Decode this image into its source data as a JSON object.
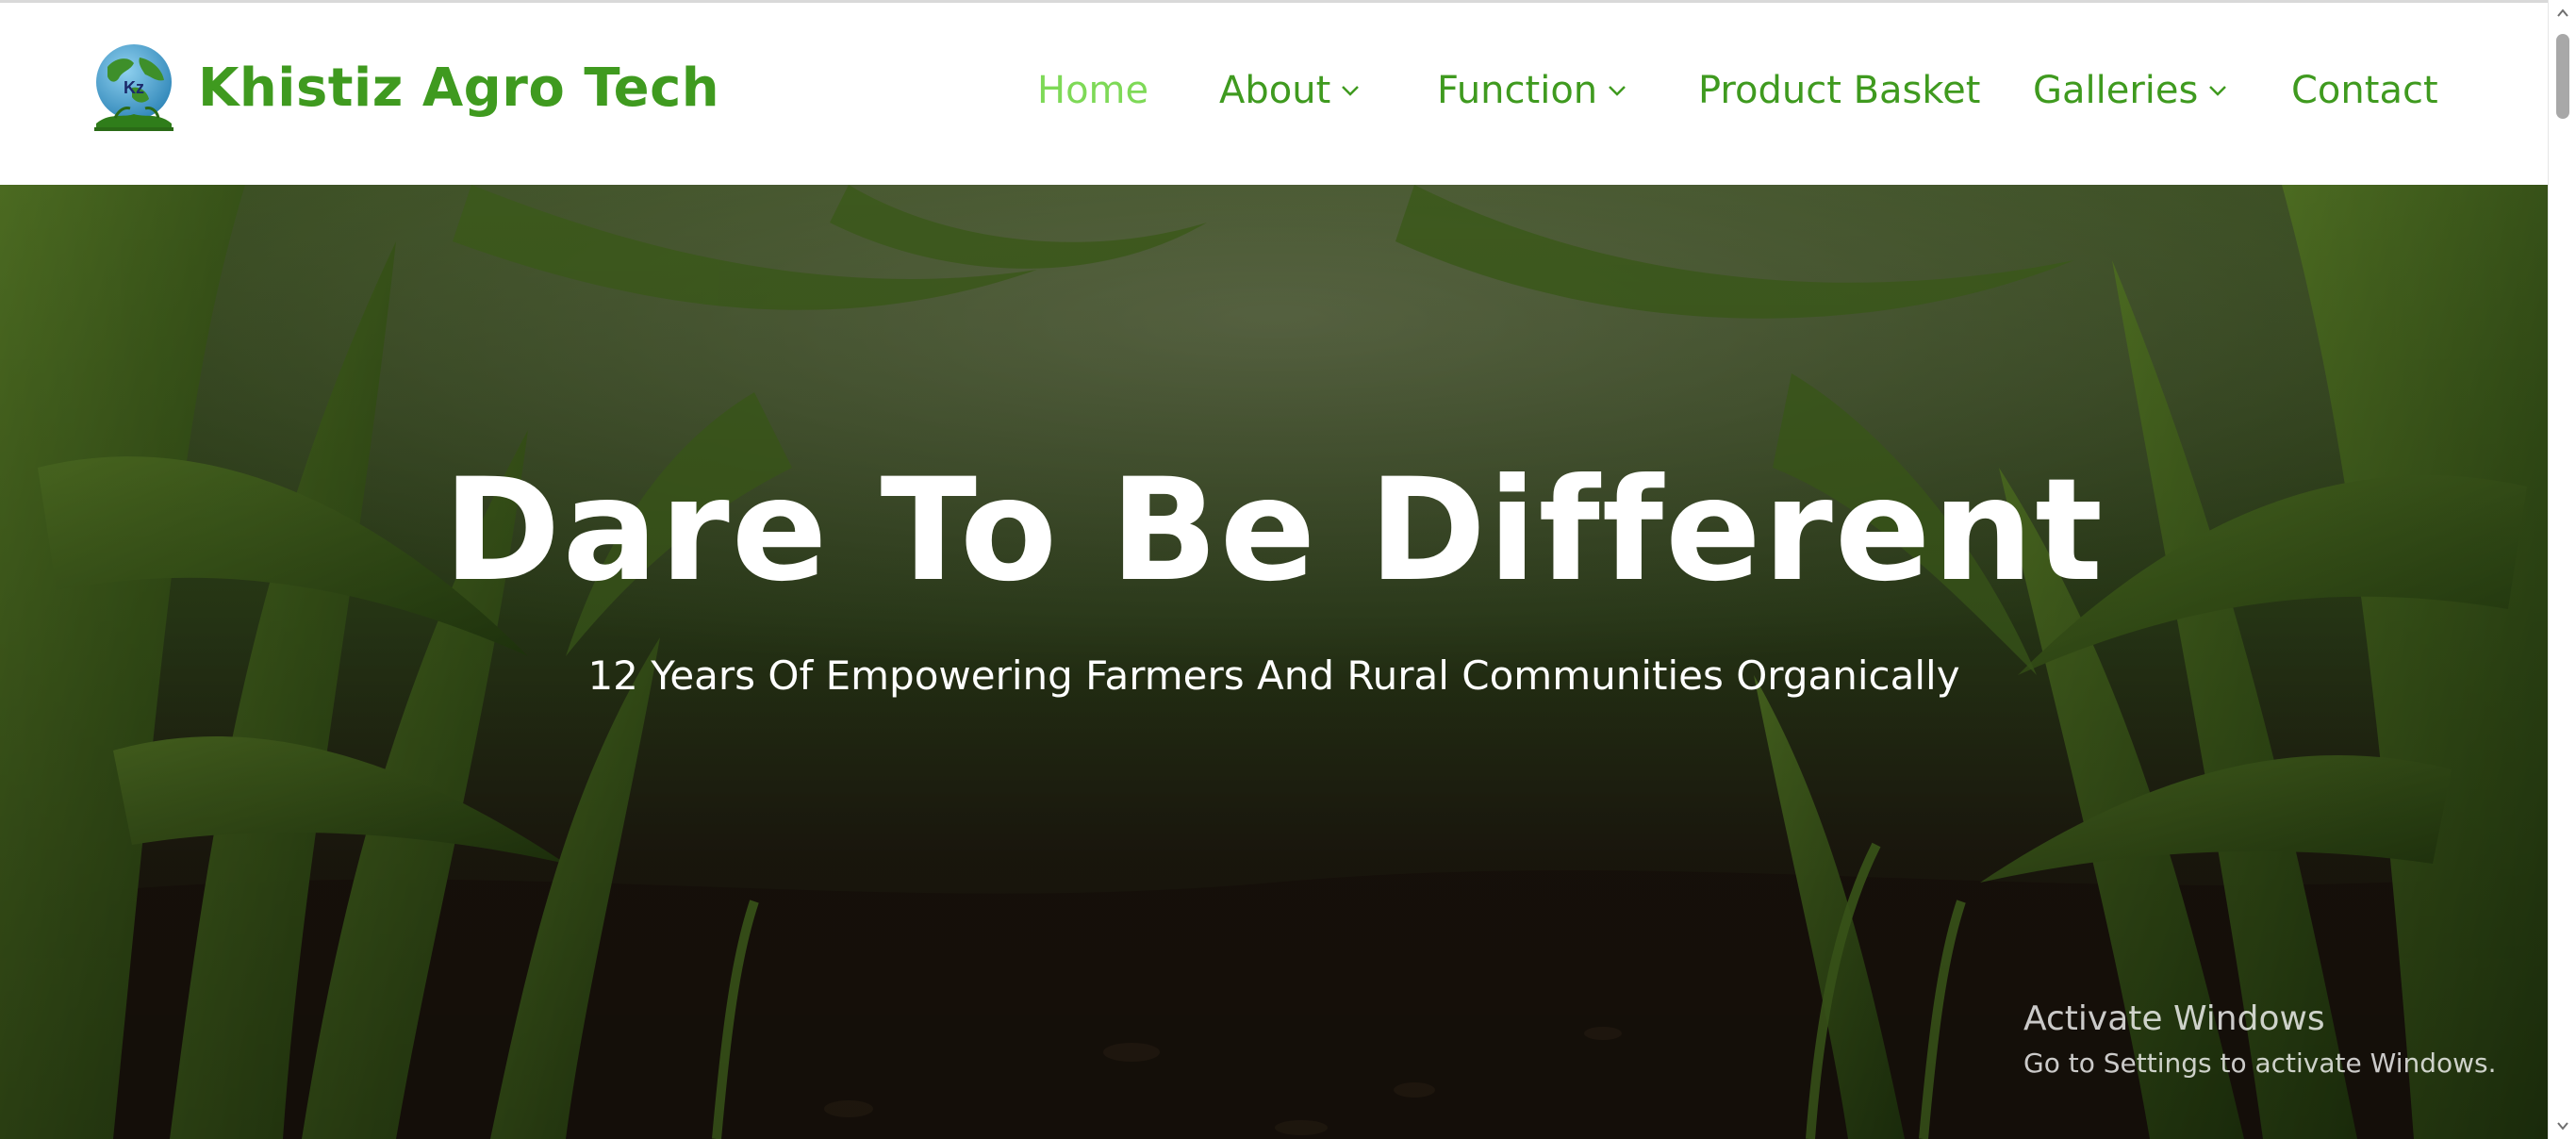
{
  "brand": {
    "name": "Khistiz Agro Tech",
    "logo_initials": "Kz"
  },
  "nav": {
    "items": [
      {
        "label": "Home",
        "active": true,
        "has_dropdown": false
      },
      {
        "label": "About",
        "active": false,
        "has_dropdown": true
      },
      {
        "label": "Function",
        "active": false,
        "has_dropdown": true
      },
      {
        "label": "Product Basket",
        "active": false,
        "has_dropdown": false
      },
      {
        "label": "Galleries",
        "active": false,
        "has_dropdown": true
      },
      {
        "label": "Contact",
        "active": false,
        "has_dropdown": false
      }
    ]
  },
  "hero": {
    "title": "Dare To Be Different",
    "subtitle": "12 Years Of Empowering Farmers And Rural Communities Organically"
  },
  "watermark": {
    "title": "Activate Windows",
    "subtitle": "Go to Settings to activate Windows."
  },
  "colors": {
    "brand_green": "#3f9a1f",
    "active_nav": "#7ed957",
    "hero_text": "#ffffff"
  },
  "icons": [
    "logo-globe-icon",
    "chevron-down-icon",
    "scroll-up-icon",
    "scroll-down-icon"
  ]
}
